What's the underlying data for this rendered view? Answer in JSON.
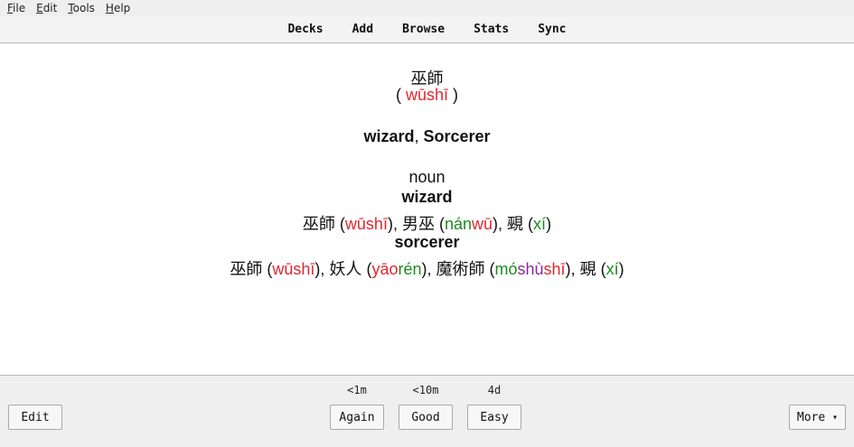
{
  "menu": {
    "file": {
      "first": "F",
      "rest": "ile"
    },
    "edit": {
      "first": "E",
      "rest": "dit"
    },
    "tools": {
      "first": "T",
      "rest": "ools"
    },
    "help": {
      "first": "H",
      "rest": "elp"
    }
  },
  "toolbar": {
    "decks": "Decks",
    "add": "Add",
    "browse": "Browse",
    "stats": "Stats",
    "sync": "Sync"
  },
  "card": {
    "hanzi": "巫師",
    "pinyin_open": "( ",
    "pinyin": "wūshī",
    "pinyin_close": " )",
    "definition_1": "wizard",
    "definition_sep": ", ",
    "definition_2": "Sorcerer",
    "pos": "noun",
    "sense1": {
      "heading": "wizard",
      "words": [
        {
          "hanzi": "巫師",
          "syllables": [
            {
              "text": "wūshī",
              "tone": "red"
            }
          ]
        },
        {
          "hanzi": "男巫",
          "syllables": [
            {
              "text": "nán",
              "tone": "green"
            },
            {
              "text": "wū",
              "tone": "red"
            }
          ]
        },
        {
          "hanzi": "覡",
          "syllables": [
            {
              "text": "xí",
              "tone": "green"
            }
          ]
        }
      ]
    },
    "sense2": {
      "heading": "sorcerer",
      "words": [
        {
          "hanzi": "巫師",
          "syllables": [
            {
              "text": "wūshī",
              "tone": "red"
            }
          ]
        },
        {
          "hanzi": "妖人",
          "syllables": [
            {
              "text": "yāo",
              "tone": "red"
            },
            {
              "text": "rén",
              "tone": "green"
            }
          ]
        },
        {
          "hanzi": "魔術師",
          "syllables": [
            {
              "text": "mó",
              "tone": "green"
            },
            {
              "text": "shù",
              "tone": "purple"
            },
            {
              "text": "shī",
              "tone": "red"
            }
          ]
        },
        {
          "hanzi": "覡",
          "syllables": [
            {
              "text": "xí",
              "tone": "green"
            }
          ]
        }
      ]
    }
  },
  "tone_colors": {
    "red": "#e3262e",
    "green": "#1f8a1f",
    "purple": "#8a2a9a"
  },
  "bottom": {
    "edit": "Edit",
    "again": {
      "label": "Again",
      "due": "<1m"
    },
    "good": {
      "label": "Good",
      "due": "<10m"
    },
    "easy": {
      "label": "Easy",
      "due": "4d"
    },
    "more": "More",
    "more_arrow": "▾"
  }
}
